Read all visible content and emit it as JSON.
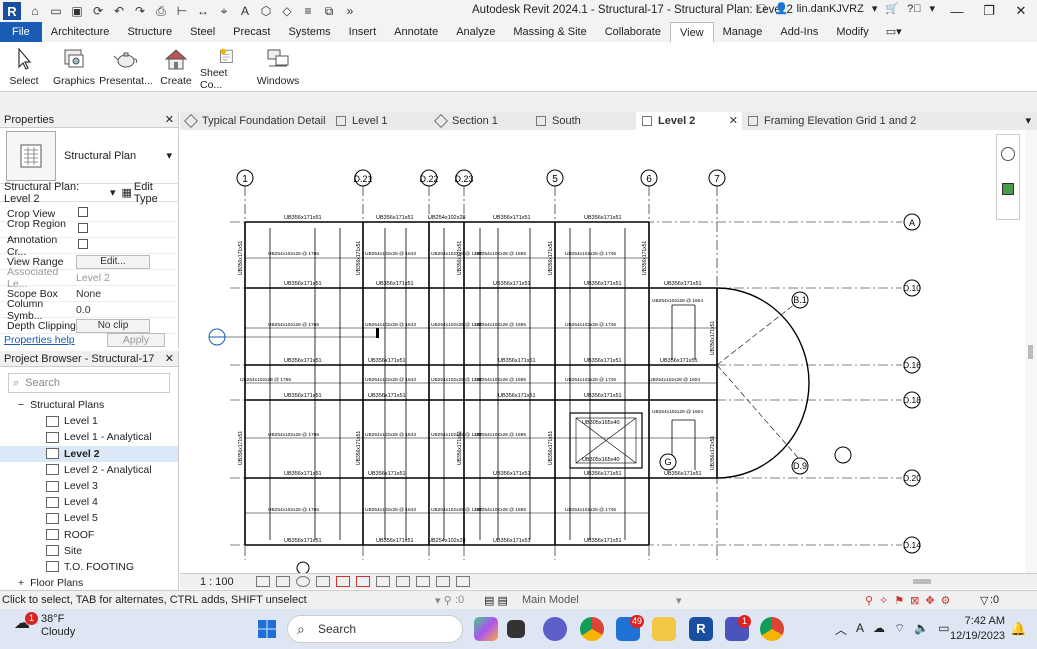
{
  "window": {
    "title": "Autodesk Revit 2024.1 - Structural-17 - Structural Plan: Level 2",
    "user": "lin.danKJVRZ",
    "app_badge": "R"
  },
  "ribbon_tabs": [
    "File",
    "Architecture",
    "Structure",
    "Steel",
    "Precast",
    "Systems",
    "Insert",
    "Annotate",
    "Analyze",
    "Massing & Site",
    "Collaborate",
    "View",
    "Manage",
    "Add-Ins",
    "Modify"
  ],
  "ribbon_active": "View",
  "ribbon_buttons": [
    {
      "label": "Select",
      "icon": "cursor-icon"
    },
    {
      "label": "Graphics",
      "icon": "graphics-icon"
    },
    {
      "label": "Presentat...",
      "icon": "teapot-icon"
    },
    {
      "label": "Create",
      "icon": "house-icon"
    },
    {
      "label": "Sheet Co...",
      "icon": "sheet-icon"
    },
    {
      "label": "Windows",
      "icon": "windows-icon"
    }
  ],
  "properties": {
    "header": "Properties",
    "type_name": "Structural Plan",
    "type_selector": "Structural Plan: Level 2",
    "edit_type": "Edit Type",
    "rows": [
      {
        "key": "Crop View",
        "value": "",
        "kind": "checkbox"
      },
      {
        "key": "Crop Region ...",
        "value": "",
        "kind": "checkbox"
      },
      {
        "key": "Annotation Cr...",
        "value": "",
        "kind": "checkbox"
      },
      {
        "key": "View Range",
        "value": "Edit...",
        "kind": "button"
      },
      {
        "key": "Associated Le...",
        "value": "Level 2",
        "kind": "gray"
      },
      {
        "key": "Scope Box",
        "value": "None",
        "kind": "text"
      },
      {
        "key": "Column Symb...",
        "value": "0.0",
        "kind": "text"
      },
      {
        "key": "Depth Clipping",
        "value": "No clip",
        "kind": "button"
      }
    ],
    "help_link": "Properties help",
    "apply": "Apply"
  },
  "browser": {
    "header": "Project Browser - Structural-17",
    "search_placeholder": "Search",
    "group": "Structural Plans",
    "items": [
      "Level 1",
      "Level 1 - Analytical",
      "Level 2",
      "Level 2 - Analytical",
      "Level 3",
      "Level 4",
      "Level 5",
      "ROOF",
      "Site",
      "T.O. FOOTING"
    ],
    "selected": "Level 2",
    "next_group": "Floor Plans"
  },
  "view_tabs": [
    "Typical Foundation Detail",
    "Level 1",
    "Section 1",
    "South",
    "Level 2",
    "Framing Elevation Grid  1 and 2"
  ],
  "view_tab_active": "Level 2",
  "plan": {
    "grid_columns": [
      "1",
      "D.21",
      "D.22",
      "D.23",
      "5",
      "6",
      "7"
    ],
    "grid_rows": [
      "A",
      "D.10",
      "D.16",
      "D.18",
      "D.20",
      "D.14"
    ],
    "bubbles": [
      "B.1",
      "G",
      "D.9"
    ],
    "beam_top": "UB356x171x51",
    "beam_small": "UB254x102x28",
    "beam_box": "UB305x165x40",
    "joist_1": "UB254x102x28 @ 1766",
    "joist_2": "UB254x102x28 @ 1643",
    "joist_3": "UB254x102x28 @ 1297",
    "joist_4": "UB254x102x28 @ 1695",
    "joist_5": "UB254x102x28 @ 1746",
    "joist_6": "UB254x102x28 @ 1604",
    "col_label": "UB356x171x51"
  },
  "view_control": {
    "scale": "1 : 100"
  },
  "status": {
    "message": "Click to select, TAB for alternates, CTRL adds, SHIFT unselect",
    "model": "Main Model",
    "workset": ":0",
    "filter": ":0"
  },
  "taskbar": {
    "temp": "38°F",
    "condition": "Cloudy",
    "search": "Search",
    "time": "7:42 AM",
    "date": "12/19/2023",
    "mail_badge": "49",
    "weather_badge": "1",
    "news_badge": "1"
  },
  "colors": {
    "file_tab": "#1a5bb5",
    "taskbar": "#dde6f2",
    "selection": "#dbe8f8"
  }
}
